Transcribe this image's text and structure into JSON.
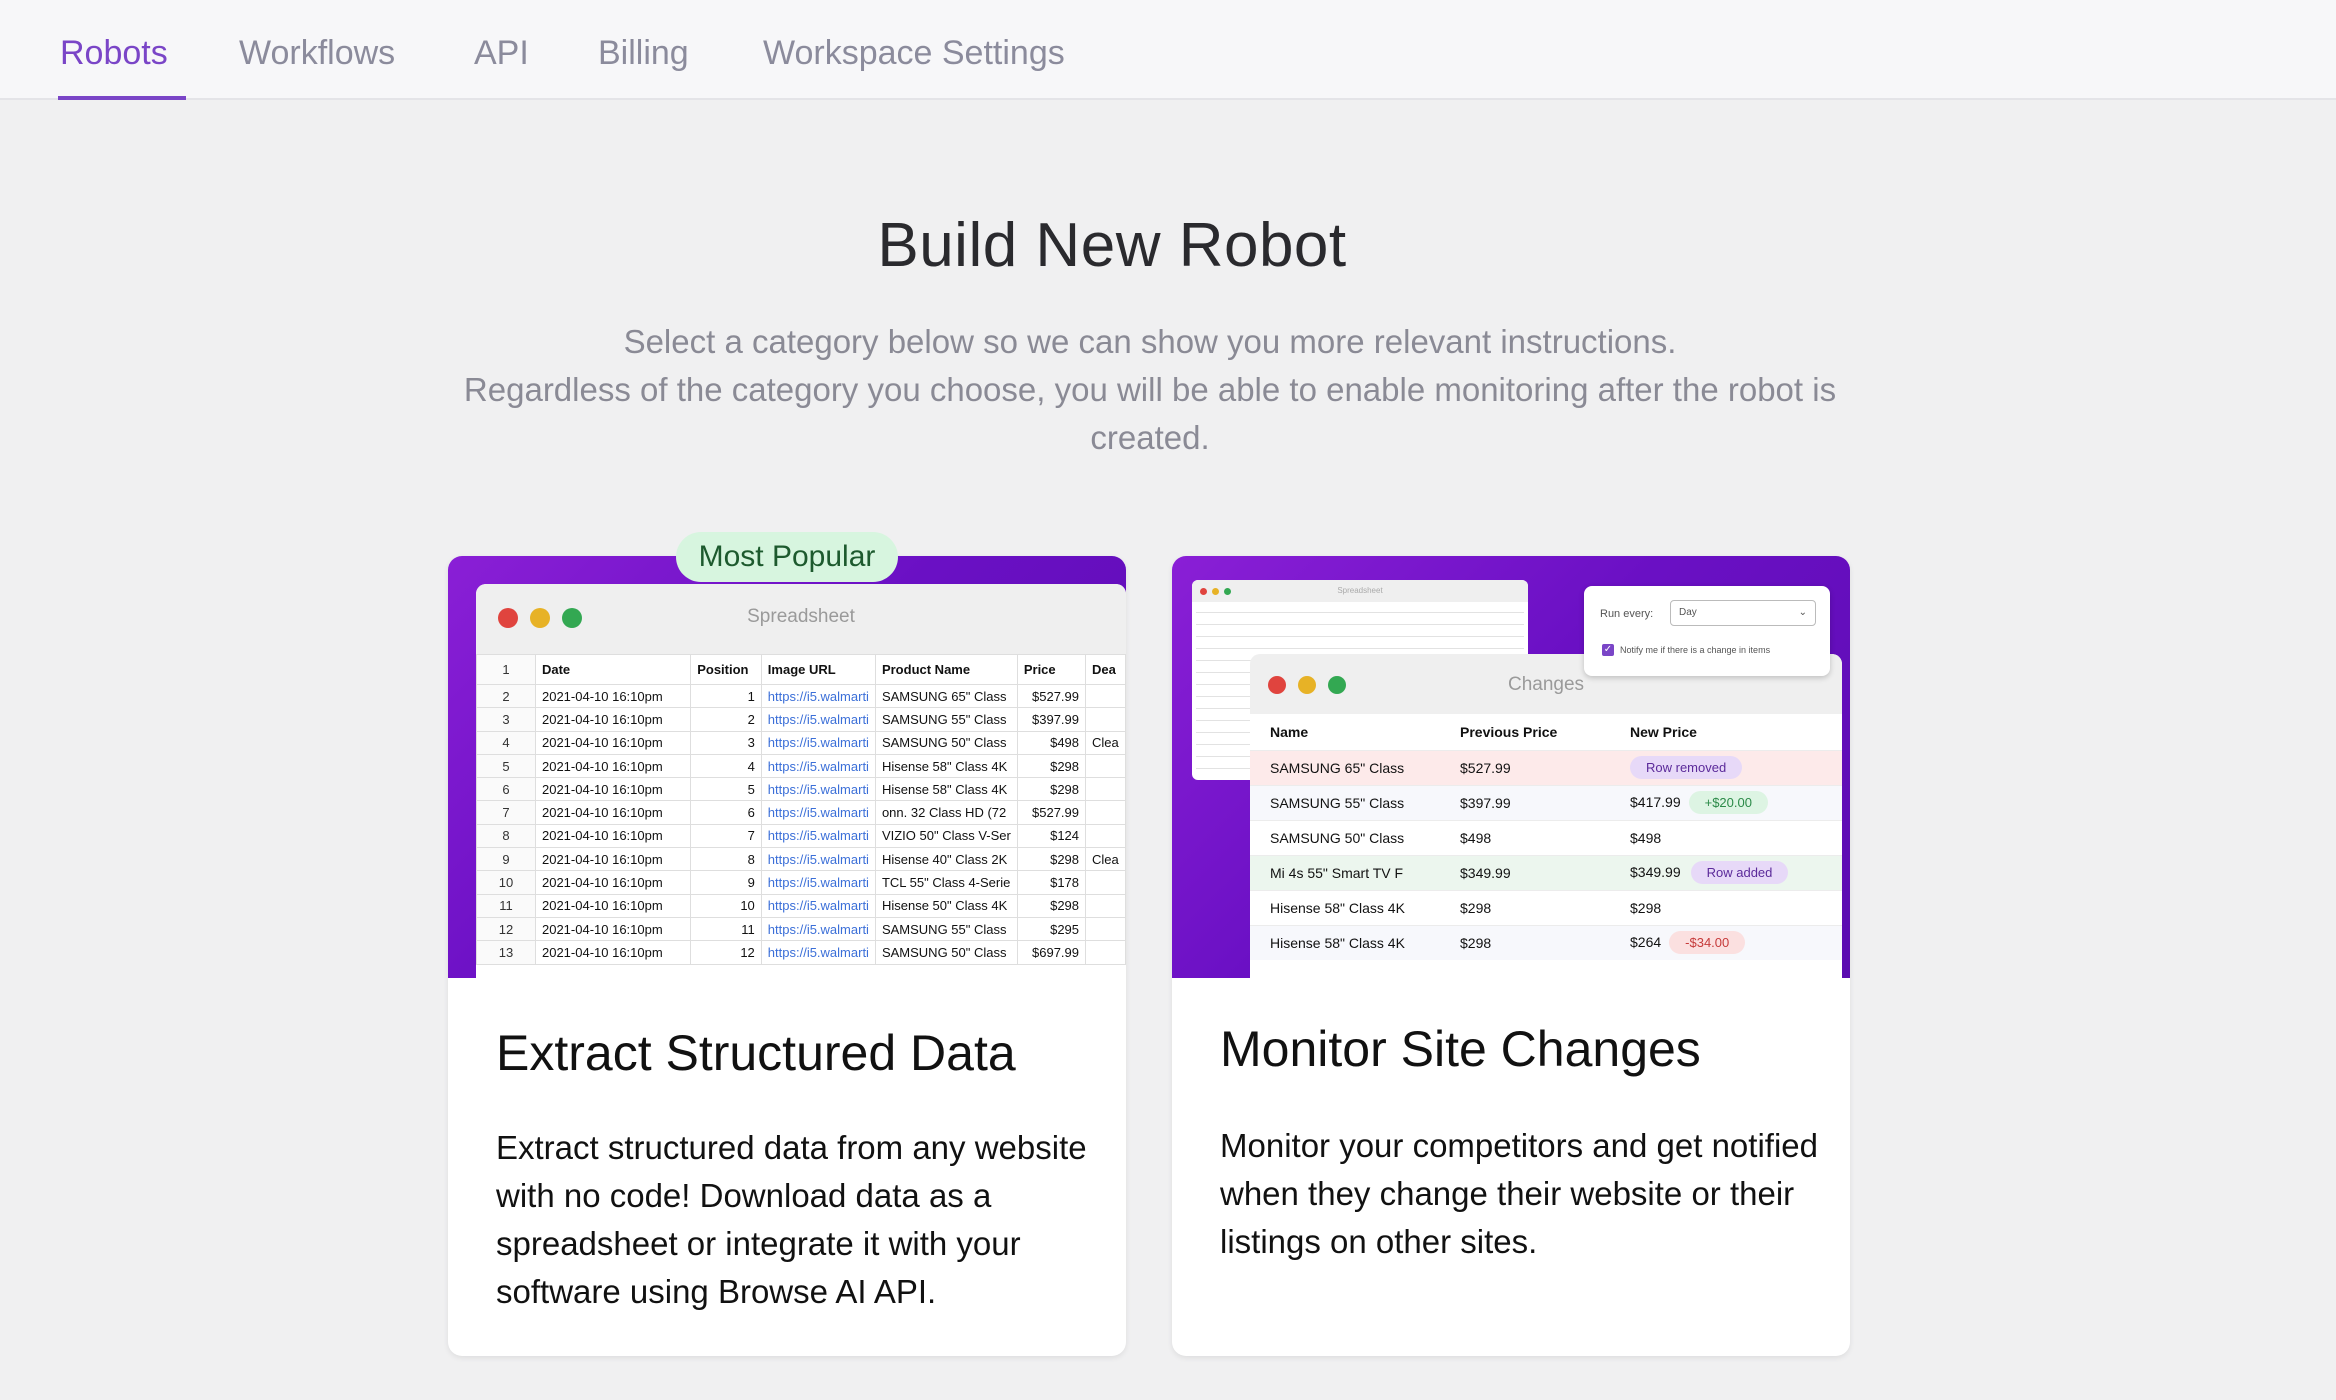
{
  "nav": {
    "tabs": [
      {
        "label": "Robots",
        "active": true
      },
      {
        "label": "Workflows"
      },
      {
        "label": "API"
      },
      {
        "label": "Billing"
      },
      {
        "label": "Workspace Settings"
      }
    ]
  },
  "heading": {
    "title": "Build New Robot",
    "subtitle_line1": "Select a category below so we can show you more relevant instructions.",
    "subtitle_line2": "Regardless of the category you choose, you will be able to enable monitoring after the robot is created."
  },
  "cards": [
    {
      "badge": "Most Popular",
      "title": "Extract Structured Data",
      "description": "Extract structured data from any website with no code! Download data as a spreadsheet or integrate it with your software using Browse AI API.",
      "preview": {
        "window_title": "Spreadsheet",
        "header_row_number": "1",
        "columns": [
          "Date",
          "Position",
          "Image URL",
          "Product Name",
          "Price",
          "Dea"
        ],
        "rows": [
          [
            "2",
            "2021-04-10 16:10pm",
            "1",
            "https://i5.walmarti",
            "SAMSUNG 65\" Class",
            "$527.99",
            ""
          ],
          [
            "3",
            "2021-04-10 16:10pm",
            "2",
            "https://i5.walmarti",
            "SAMSUNG 55\" Class",
            "$397.99",
            ""
          ],
          [
            "4",
            "2021-04-10 16:10pm",
            "3",
            "https://i5.walmarti",
            "SAMSUNG 50\" Class",
            "$498",
            "Clea"
          ],
          [
            "5",
            "2021-04-10 16:10pm",
            "4",
            "https://i5.walmarti",
            "Hisense 58\" Class 4K",
            "$298",
            ""
          ],
          [
            "6",
            "2021-04-10 16:10pm",
            "5",
            "https://i5.walmarti",
            "Hisense 58\" Class 4K",
            "$298",
            ""
          ],
          [
            "7",
            "2021-04-10 16:10pm",
            "6",
            "https://i5.walmarti",
            "onn. 32 Class HD (72",
            "$527.99",
            ""
          ],
          [
            "8",
            "2021-04-10 16:10pm",
            "7",
            "https://i5.walmarti",
            "VIZIO 50\" Class V-Ser",
            "$124",
            ""
          ],
          [
            "9",
            "2021-04-10 16:10pm",
            "8",
            "https://i5.walmarti",
            "Hisense 40\" Class 2K",
            "$298",
            "Clea"
          ],
          [
            "10",
            "2021-04-10 16:10pm",
            "9",
            "https://i5.walmarti",
            "TCL 55\" Class 4-Serie",
            "$178",
            ""
          ],
          [
            "11",
            "2021-04-10 16:10pm",
            "10",
            "https://i5.walmarti",
            "Hisense 50\" Class 4K",
            "$298",
            ""
          ],
          [
            "12",
            "2021-04-10 16:10pm",
            "11",
            "https://i5.walmarti",
            "SAMSUNG 55\" Class",
            "$295",
            ""
          ],
          [
            "13",
            "2021-04-10 16:10pm",
            "12",
            "https://i5.walmarti",
            "SAMSUNG 50\" Class",
            "$697.99",
            ""
          ]
        ]
      }
    },
    {
      "title": "Monitor Site Changes",
      "description": "Monitor your competitors and get notified when they change their website or their listings on other sites.",
      "preview": {
        "mini_title": "Spreadsheet",
        "popup": {
          "run_every_label": "Run every:",
          "run_every_value": "Day",
          "notify_label": "Notify me if there is a change in items"
        },
        "window_title": "Changes",
        "columns": [
          "Name",
          "Previous Price",
          "New Price"
        ],
        "rows": [
          {
            "name": "SAMSUNG 65\" Class",
            "prev": "$527.99",
            "new": "",
            "tag": "Row removed",
            "tag_type": "purple",
            "row_type": "removed"
          },
          {
            "name": "SAMSUNG 55\" Class",
            "prev": "$397.99",
            "new": "$417.99",
            "tag": "+$20.00",
            "tag_type": "green",
            "row_type": "alt"
          },
          {
            "name": "SAMSUNG 50\" Class",
            "prev": "$498",
            "new": "$498",
            "tag": "",
            "tag_type": "",
            "row_type": ""
          },
          {
            "name": "Mi 4s 55\" Smart TV F",
            "prev": "$349.99",
            "new": "$349.99",
            "tag": "Row added",
            "tag_type": "purple",
            "row_type": "added"
          },
          {
            "name": "Hisense 58\" Class 4K",
            "prev": "$298",
            "new": "$298",
            "tag": "",
            "tag_type": "",
            "row_type": ""
          },
          {
            "name": "Hisense 58\" Class 4K",
            "prev": "$298",
            "new": "$264",
            "tag": "-$34.00",
            "tag_type": "red",
            "row_type": "alt"
          }
        ]
      }
    }
  ]
}
